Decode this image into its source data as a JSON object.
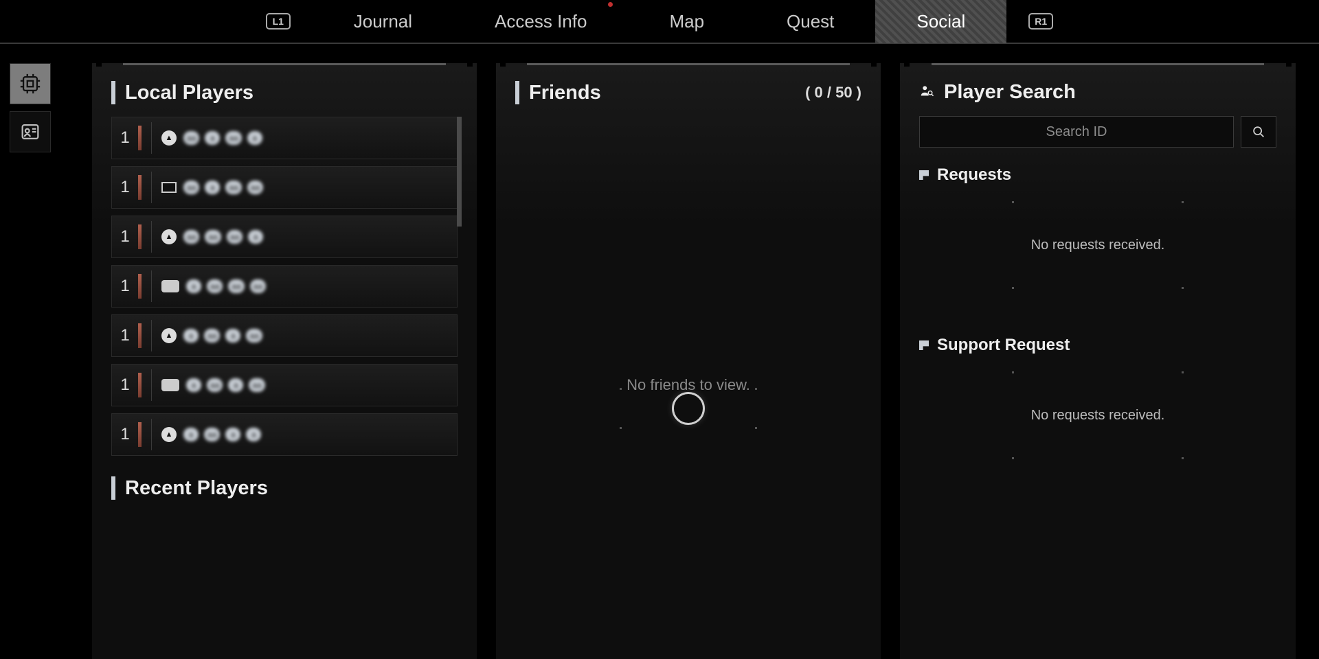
{
  "topbar": {
    "bumper_left": "L1",
    "bumper_right": "R1",
    "tabs": [
      {
        "label": "Journal",
        "active": false,
        "notif": false
      },
      {
        "label": "Access Info",
        "active": false,
        "notif": true
      },
      {
        "label": "Map",
        "active": false,
        "notif": false
      },
      {
        "label": "Quest",
        "active": false,
        "notif": false
      },
      {
        "label": "Social",
        "active": true,
        "notif": false
      }
    ]
  },
  "left_panel": {
    "local_players_title": "Local Players",
    "recent_players_title": "Recent Players",
    "players": [
      {
        "level": "1",
        "platform": "ps"
      },
      {
        "level": "1",
        "platform": "pc"
      },
      {
        "level": "1",
        "platform": "ps"
      },
      {
        "level": "1",
        "platform": "pad"
      },
      {
        "level": "1",
        "platform": "ps"
      },
      {
        "level": "1",
        "platform": "pad"
      },
      {
        "level": "1",
        "platform": "ps"
      }
    ]
  },
  "mid_panel": {
    "friends_title": "Friends",
    "friends_count": "( 0 / 50 )",
    "empty_text": "No friends to view."
  },
  "right_panel": {
    "search_title": "Player Search",
    "search_placeholder": "Search ID",
    "requests_title": "Requests",
    "requests_empty": "No requests received.",
    "support_title": "Support Request",
    "support_empty": "No requests received."
  }
}
